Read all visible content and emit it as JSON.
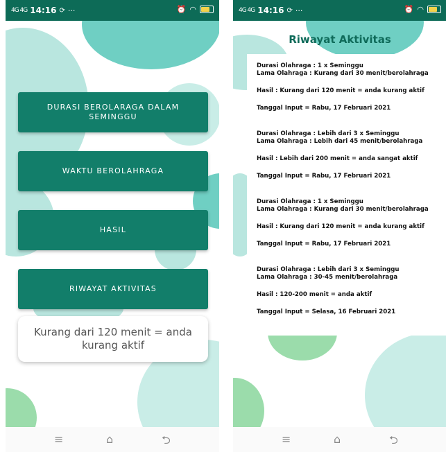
{
  "colors": {
    "statusbar": "#0d6b57",
    "button": "#127e6a",
    "blob_teal": "#6fcfc3",
    "blob_light": "#b9e6df",
    "blob_green": "#9bdcab",
    "title": "#0f6b5a"
  },
  "statusbar": {
    "signal": "4G 4G",
    "time": "14:16",
    "sync_icon": "sync-icon",
    "more": "···",
    "alarm_icon": "alarm-icon",
    "wifi_icon": "wifi-icon",
    "battery_icon": "battery-icon"
  },
  "menu": {
    "buttons": [
      {
        "label": "DURASI BEROLARAGA DALAM SEMINGGU"
      },
      {
        "label": "WAKTU BEROLAHRAGA"
      },
      {
        "label": "HASIL"
      },
      {
        "label": "RIWAYAT AKTIVITAS"
      }
    ],
    "result_text": "Kurang dari 120 menit = anda kurang aktif"
  },
  "history": {
    "title": "Riwayat Aktivitas",
    "records": [
      {
        "durasi": "Durasi Olahraga : 1 x Seminggu",
        "lama": "Lama Olahraga : Kurang dari 30 menit/berolahraga",
        "hasil": "Hasil : Kurang dari 120 menit = anda kurang aktif",
        "tanggal": "Tanggal Input = Rabu, 17 Februari 2021"
      },
      {
        "durasi": "Durasi Olahraga : Lebih dari 3 x Seminggu",
        "lama": "Lama Olahraga : Lebih dari 45 menit/berolahraga",
        "hasil": "Hasil : Lebih dari 200 menit = anda sangat aktif",
        "tanggal": "Tanggal Input = Rabu, 17 Februari 2021"
      },
      {
        "durasi": "Durasi Olahraga : 1 x Seminggu",
        "lama": "Lama Olahraga : Kurang dari 30 menit/berolahraga",
        "hasil": "Hasil : Kurang dari 120 menit = anda kurang aktif",
        "tanggal": "Tanggal Input = Rabu, 17 Februari 2021"
      },
      {
        "durasi": "Durasi Olahraga : Lebih dari 3 x Seminggu",
        "lama": "Lama Olahraga : 30-45 menit/berolahraga",
        "hasil": "Hasil : 120-200 menit = anda aktif",
        "tanggal": "Tanggal Input = Selasa, 16 Februari 2021"
      }
    ]
  },
  "navbar": {
    "menu_icon": "≡",
    "home_icon": "⌂",
    "back_icon": "⮌"
  }
}
